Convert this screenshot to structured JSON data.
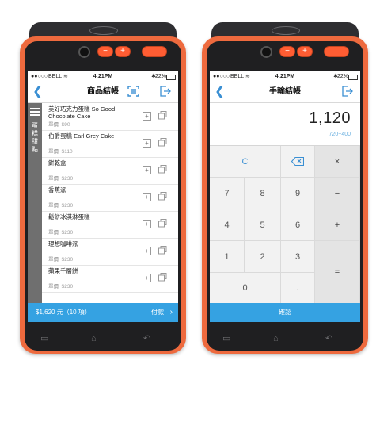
{
  "status": {
    "carrier": "BELL",
    "time": "4:21PM",
    "battery": "22%"
  },
  "left": {
    "title": "商品結帳",
    "category": "蛋糕甜點",
    "items": [
      {
        "name": "美好巧克力蛋糕 So Good Chocolate Cake",
        "price_label": "單價",
        "price": "$90"
      },
      {
        "name": "伯爵蛋糕 Earl Grey Cake",
        "price_label": "單價",
        "price": "$110"
      },
      {
        "name": "餅乾盒",
        "price_label": "單價",
        "price": "$230"
      },
      {
        "name": "香蕉派",
        "price_label": "單價",
        "price": "$230"
      },
      {
        "name": "鬆餅冰淇淋蛋糕",
        "price_label": "單價",
        "price": "$230"
      },
      {
        "name": "理想咖啡派",
        "price_label": "單價",
        "price": "$230"
      },
      {
        "name": "蘋果千層餅",
        "price_label": "單價",
        "price": "$230"
      }
    ],
    "bottom": {
      "total": "$1,620 元（10 項）",
      "pay": "付款"
    }
  },
  "right": {
    "title": "手輸結帳",
    "amount": "1,120",
    "expression": "720+400",
    "keys": {
      "clear": "C",
      "multiply": "×",
      "n7": "7",
      "n8": "8",
      "n9": "9",
      "minus": "−",
      "n4": "4",
      "n5": "5",
      "n6": "6",
      "plus": "+",
      "n1": "1",
      "n2": "2",
      "n3": "3",
      "equals": "=",
      "n0": "0",
      "dot": "."
    },
    "confirm": "確認"
  },
  "hardware": {
    "minus": "−",
    "plus": "+"
  },
  "colors": {
    "device": "#ee6a3e",
    "accent": "#35a2e2",
    "link": "#3a8fd3"
  },
  "icons": [
    "back-arrow-icon",
    "scan-icon",
    "logout-icon",
    "menu-list-icon",
    "plus-icon",
    "copy-icon",
    "backspace-icon",
    "wifi-icon",
    "battery-icon",
    "chevron-right-icon"
  ]
}
